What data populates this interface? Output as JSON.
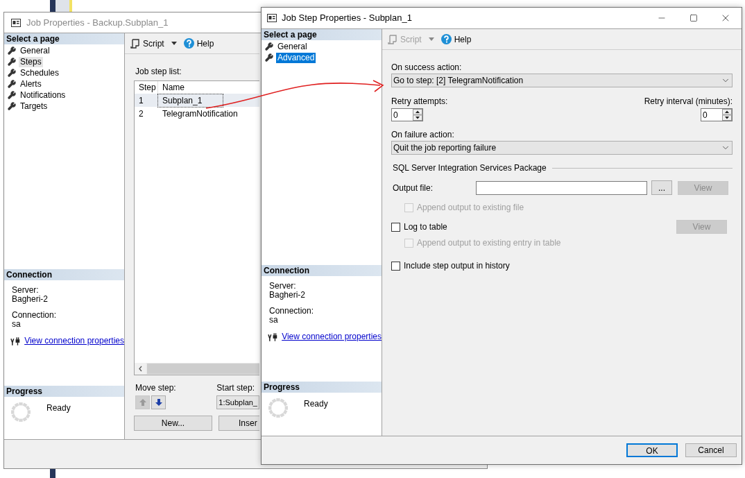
{
  "back_window": {
    "title": "Job Properties - Backup.Subplan_1",
    "page_selector": {
      "header": "Select a page",
      "items": [
        {
          "label": "General",
          "selected": false
        },
        {
          "label": "Steps",
          "selected": true
        },
        {
          "label": "Schedules",
          "selected": false
        },
        {
          "label": "Alerts",
          "selected": false
        },
        {
          "label": "Notifications",
          "selected": false
        },
        {
          "label": "Targets",
          "selected": false
        }
      ]
    },
    "connection": {
      "header": "Connection",
      "server_label": "Server:",
      "server": "Bagheri-2",
      "connection_label": "Connection:",
      "connection": "sa",
      "link": "View connection properties"
    },
    "progress": {
      "header": "Progress",
      "status": "Ready"
    },
    "toolbar": {
      "script": {
        "label": "Script",
        "disabled": false
      },
      "help": "Help"
    },
    "step_list": {
      "label": "Job step list:",
      "columns": [
        "Step",
        "Name"
      ],
      "rows": [
        {
          "step": "1",
          "name": "Subplan_1",
          "selected": true
        },
        {
          "step": "2",
          "name": "TelegramNotification",
          "selected": false
        }
      ]
    },
    "move_step": {
      "label": "Move step:",
      "up_disabled": true,
      "down_disabled": false
    },
    "start_step": {
      "label": "Start step:",
      "value": "1:Subplan_"
    },
    "buttons": [
      "New...",
      "Inser"
    ]
  },
  "front_window": {
    "title": "Job Step Properties - Subplan_1",
    "page_selector": {
      "header": "Select a page",
      "items": [
        {
          "label": "General",
          "selected": false
        },
        {
          "label": "Advanced",
          "selected": true
        }
      ]
    },
    "connection": {
      "header": "Connection",
      "server_label": "Server:",
      "server": "Bagheri-2",
      "connection_label": "Connection:",
      "connection": "sa",
      "link": "View connection properties"
    },
    "progress": {
      "header": "Progress",
      "status": "Ready"
    },
    "toolbar": {
      "script": {
        "label": "Script",
        "disabled": true
      },
      "help": "Help"
    },
    "success_action": {
      "label": "On success action:",
      "value": "Go to step: [2] TelegramNotification"
    },
    "retry_attempts": {
      "label": "Retry attempts:",
      "value": "0"
    },
    "retry_interval": {
      "label": "Retry interval (minutes):",
      "value": "0"
    },
    "failure_action": {
      "label": "On failure action:",
      "value": "Quit the job reporting failure"
    },
    "ssis_group": "SQL Server Integration Services Package",
    "output_file": {
      "label": "Output file:",
      "browse": "...",
      "view": {
        "label": "View",
        "disabled": true
      }
    },
    "append_file": {
      "label": "Append output to existing file",
      "checked": false,
      "disabled": true
    },
    "log_to_table": {
      "label": "Log to table",
      "checked": false,
      "disabled": false
    },
    "log_view": {
      "label": "View",
      "disabled": true
    },
    "append_table": {
      "label": "Append output to existing entry in table",
      "checked": false,
      "disabled": true
    },
    "include_history": {
      "label": "Include step output in history",
      "checked": false,
      "disabled": false
    },
    "buttons": [
      {
        "label": "OK",
        "default": true
      },
      {
        "label": "Cancel",
        "default": false
      }
    ]
  }
}
